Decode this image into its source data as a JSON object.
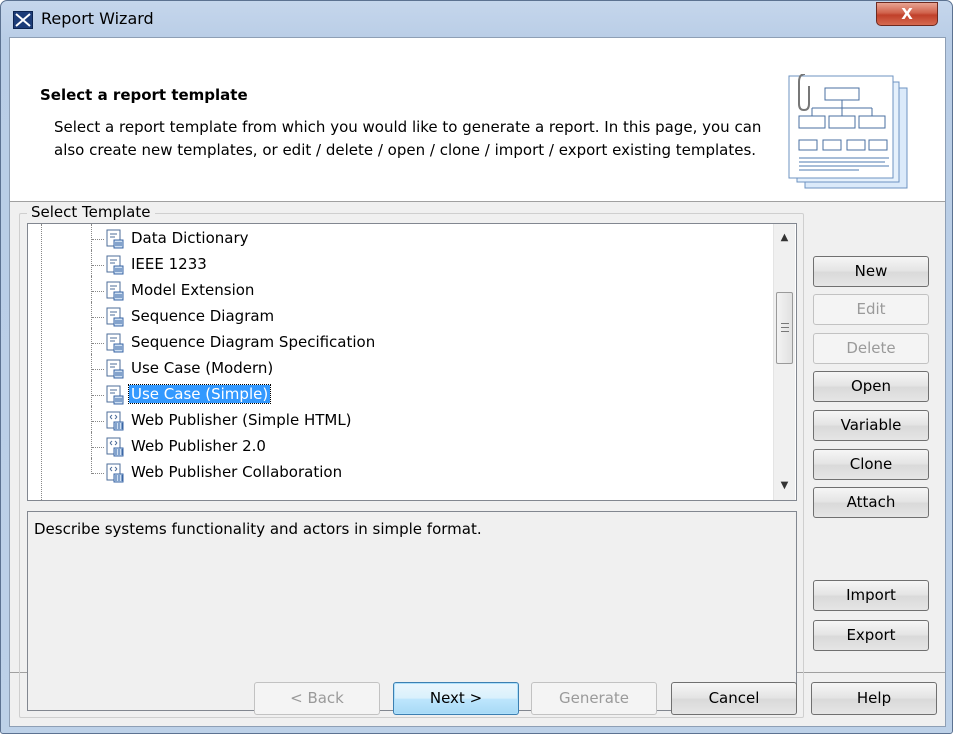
{
  "window": {
    "title": "Report Wizard",
    "close_glyph": "X"
  },
  "header": {
    "title": "Select a report template",
    "description": "Select a report template from which you would like to generate a report. In this page, you can also create new templates, or edit / delete / open / clone / import / export existing templates.",
    "image_icon": "report-template-illustration"
  },
  "template_group": {
    "label": "Select Template",
    "items": [
      {
        "label": "Data Dictionary",
        "icon": "report-template-icon",
        "selected": false
      },
      {
        "label": "IEEE 1233",
        "icon": "report-template-icon",
        "selected": false
      },
      {
        "label": "Model Extension",
        "icon": "report-template-icon",
        "selected": false
      },
      {
        "label": "Sequence Diagram",
        "icon": "report-template-icon",
        "selected": false
      },
      {
        "label": "Sequence Diagram Specification",
        "icon": "report-template-icon",
        "selected": false
      },
      {
        "label": "Use Case (Modern)",
        "icon": "report-template-icon",
        "selected": false
      },
      {
        "label": "Use Case (Simple)",
        "icon": "report-template-icon",
        "selected": true
      },
      {
        "label": "Web Publisher (Simple HTML)",
        "icon": "web-template-icon",
        "selected": false
      },
      {
        "label": "Web Publisher 2.0",
        "icon": "web-template-icon",
        "selected": false
      },
      {
        "label": "Web Publisher Collaboration",
        "icon": "web-template-icon",
        "selected": false
      }
    ],
    "description": "Describe systems functionality and actors in simple format."
  },
  "side_buttons": {
    "new": "New",
    "edit": "Edit",
    "delete": "Delete",
    "open": "Open",
    "variable": "Variable",
    "clone": "Clone",
    "attach": "Attach",
    "import": "Import",
    "export": "Export"
  },
  "footer_buttons": {
    "back": "< Back",
    "next": "Next >",
    "generate": "Generate",
    "cancel": "Cancel",
    "help": "Help"
  },
  "colors": {
    "selection": "#3399ff",
    "title_bar": "#c5d6ec",
    "close_button": "#c0402a"
  }
}
